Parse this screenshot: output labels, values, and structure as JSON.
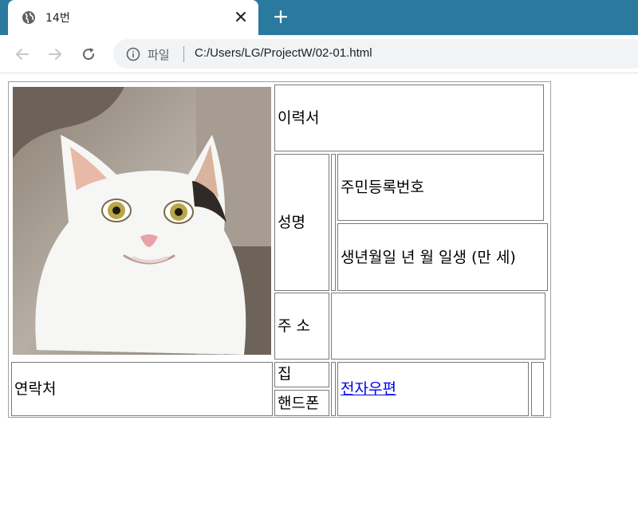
{
  "browser": {
    "tab_title": "14번",
    "site_label": "파일",
    "url": "C:/Users/LG/ProjectW/02-01.html"
  },
  "icons": {
    "favicon": "globe-icon",
    "close": "close-icon",
    "new_tab": "plus-icon",
    "back": "arrow-left-icon",
    "forward": "arrow-right-icon",
    "reload": "reload-icon",
    "info": "info-icon"
  },
  "resume": {
    "title": "이력서",
    "name_label": "성명",
    "resident_number_label": "주민등록번호",
    "birth_text": "생년월일 년 월 일생 (만 세)",
    "address_label": "주 소",
    "contact_label": "연락처",
    "home_label": "집",
    "mobile_label": "핸드폰",
    "email_link": "전자우편"
  },
  "colors": {
    "tabstrip": "#2a7aa0",
    "link": "#0000ee"
  }
}
